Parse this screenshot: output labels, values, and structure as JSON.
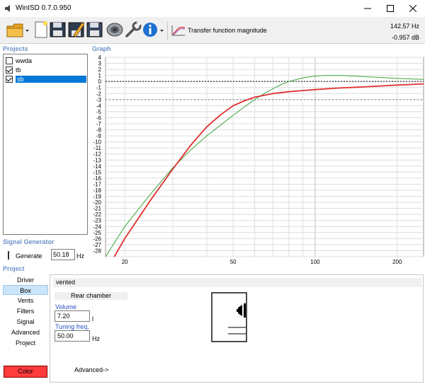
{
  "window": {
    "title": "WinISD 0.7.0.950",
    "icons": {
      "app": "speaker-app-icon",
      "minimize": "minimize-icon",
      "maximize": "maximize-icon",
      "close": "close-icon"
    }
  },
  "toolbar": {
    "function_label": "Transfer function magnitude",
    "readout_freq": "142.57 Hz",
    "readout_db": "-0.957 dB",
    "icons": [
      "open-folder-icon",
      "new-file-icon",
      "save-icon",
      "edit-icon",
      "save-as-icon",
      "driver-icon",
      "wrench-icon",
      "info-icon",
      "graph-icon"
    ]
  },
  "projects": {
    "label": "Projects",
    "items": [
      {
        "name": "wwda",
        "checked": false,
        "selected": false
      },
      {
        "name": "tb",
        "checked": true,
        "selected": false
      },
      {
        "name": "sb",
        "checked": true,
        "selected": true
      }
    ]
  },
  "graph": {
    "label": "Graph"
  },
  "chart_data": {
    "type": "line",
    "title": "",
    "xlabel": "",
    "ylabel": "",
    "x_scale": "log",
    "xlim": [
      17,
      250
    ],
    "ylim": [
      -29,
      4
    ],
    "x_tick_labels": [
      "20",
      "50",
      "100",
      "200"
    ],
    "y_tick_labels": [
      "4",
      "3",
      "2",
      "1",
      "0",
      "-1",
      "-2",
      "-3",
      "-4",
      "-5",
      "-6",
      "-7",
      "-8",
      "-9",
      "-10",
      "-11",
      "-12",
      "-13",
      "-14",
      "-15",
      "-16",
      "-17",
      "-18",
      "-19",
      "-20",
      "-21",
      "-22",
      "-23",
      "-24",
      "-25",
      "-26",
      "-27",
      "-28"
    ],
    "grid": true,
    "reference_lines": [
      0,
      -3
    ],
    "series": [
      {
        "color": "#e03030",
        "x": [
          17,
          20,
          25,
          30,
          35,
          40,
          45,
          50,
          55,
          60,
          65,
          70,
          80,
          90,
          100,
          120,
          150,
          200,
          250
        ],
        "y": [
          -31.5,
          -26,
          -19.5,
          -14.5,
          -10.5,
          -7.5,
          -5.5,
          -4,
          -3.2,
          -2.6,
          -2.3,
          -2,
          -1.7,
          -1.5,
          -1.35,
          -1.1,
          -0.9,
          -0.6,
          -0.4
        ]
      },
      {
        "color": "#3aa53a",
        "x": [
          17,
          20,
          25,
          30,
          35,
          40,
          45,
          50,
          55,
          60,
          65,
          70,
          75,
          80,
          90,
          100,
          110,
          125,
          150,
          200,
          250
        ],
        "y": [
          -29,
          -24,
          -18.5,
          -14.3,
          -11.3,
          -9,
          -7.2,
          -5.6,
          -4.2,
          -3,
          -2,
          -1.2,
          -0.5,
          0,
          0.6,
          0.9,
          1,
          1,
          0.8,
          0.5,
          0.35
        ]
      }
    ]
  },
  "signal_generator": {
    "label": "Signal Generator",
    "generate_label": "Generate",
    "generate_checked": false,
    "frequency": "50.18",
    "unit": "Hz"
  },
  "project": {
    "label": "Project",
    "nav": [
      {
        "label": "Driver",
        "active": false
      },
      {
        "label": "Box",
        "active": true
      },
      {
        "label": "Vents",
        "active": false
      },
      {
        "label": "Filters",
        "active": false
      },
      {
        "label": "Signal",
        "active": false
      },
      {
        "label": "Advanced",
        "active": false
      },
      {
        "label": "Project",
        "active": false
      }
    ],
    "color_button": "Color",
    "color_value": "#ff3b3b",
    "box_type": "vented",
    "rear_chamber": "Rear chamber",
    "volume_label": "Volume",
    "volume_value": "7.20",
    "volume_unit": "l",
    "tuning_label": "Tuning freq.",
    "tuning_value": "50.00",
    "tuning_unit": "Hz",
    "advanced_link": "Advanced->"
  }
}
